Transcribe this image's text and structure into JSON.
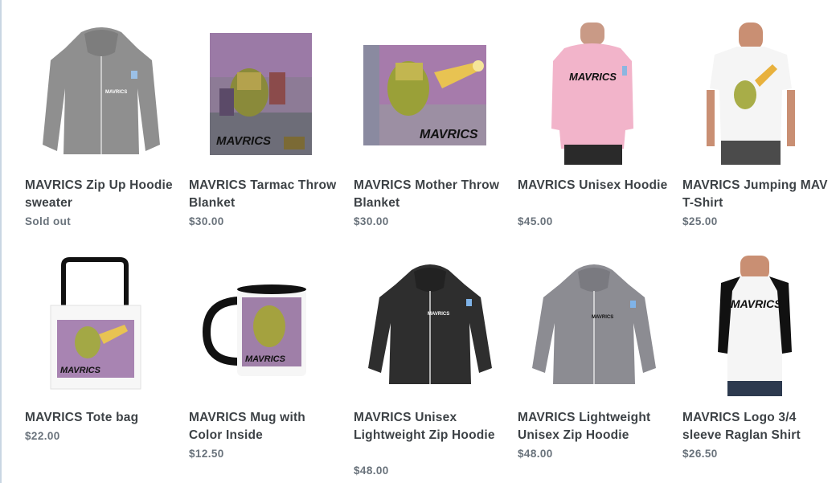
{
  "products": [
    {
      "title": "MAVRICS Zip Up Hoodie sweater",
      "price": "Sold out",
      "brand": "MAVRICS"
    },
    {
      "title": "MAVRICS Tarmac Throw Blanket",
      "price": "$30.00",
      "brand": "MAVRICS"
    },
    {
      "title": "MAVRICS Mother Throw Blanket",
      "price": "$30.00",
      "brand": "MAVRICS"
    },
    {
      "title": "MAVRICS Unisex Hoodie",
      "price": "$45.00",
      "brand": "MAVRICS"
    },
    {
      "title": "MAVRICS Jumping MAV T-Shirt",
      "price": "$25.00",
      "brand": "MAVRICS"
    },
    {
      "title": "MAVRICS Tote bag",
      "price": "$22.00",
      "brand": "MAVRICS"
    },
    {
      "title": "MAVRICS Mug with Color Inside",
      "price": "$12.50",
      "brand": "MAVRICS"
    },
    {
      "title": "MAVRICS Unisex Lightweight Zip Hoodie",
      "price": "$48.00",
      "brand": "MAVRICS"
    },
    {
      "title": "MAVRICS Lightweight Unisex Zip Hoodie",
      "price": "$48.00",
      "brand": "MAVRICS"
    },
    {
      "title": "MAVRICS Logo 3/4 sleeve Raglan Shirt",
      "price": "$26.50",
      "brand": "MAVRICS"
    }
  ]
}
